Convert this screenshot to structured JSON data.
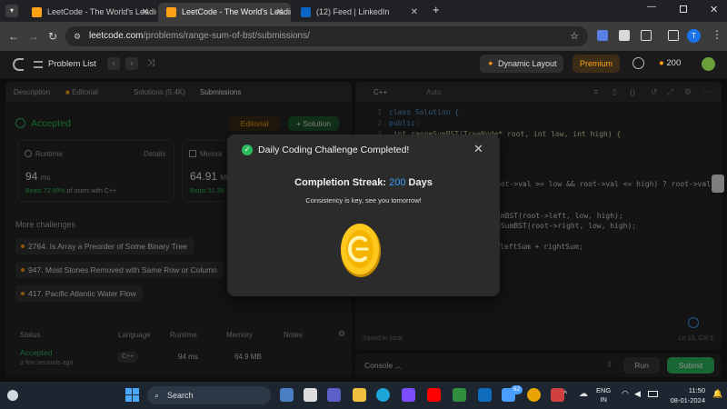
{
  "browser": {
    "tabs": [
      {
        "title": "LeetCode - The World's Leadin",
        "active": false
      },
      {
        "title": "LeetCode - The World's Leadin",
        "active": true
      },
      {
        "title": "(12) Feed | LinkedIn",
        "active": false
      }
    ],
    "url_host": "leetcode.com",
    "url_path": "/problems/range-sum-of-bst/submissions/",
    "profile_letter": "T"
  },
  "header": {
    "problem_list": "Problem List",
    "dynamic_layout": "Dynamic Layout",
    "premium": "Premium",
    "streak_count": "200"
  },
  "left_tabs": [
    "Description",
    "Editorial",
    "Solutions (5.4K)",
    "Submissions"
  ],
  "result": {
    "status": "Accepted",
    "editorial_btn": "Editorial",
    "solution_btn": "Solution",
    "runtime_label": "Runtime",
    "details": "Details",
    "runtime_value": "94",
    "runtime_unit": "ms",
    "runtime_beats": "Beats 72.99%",
    "runtime_beats_suffix": "of users with C++",
    "memory_label": "Memor",
    "memory_value": "64.91",
    "memory_unit": "MB",
    "memory_beats": "Beats 51.38"
  },
  "more_challenges": {
    "title": "More challenges",
    "items": [
      "2764. Is Array a Preorder of Some Binary Tree",
      "947. Most Stones Removed with Same Row or Column",
      "417. Pacific Atlantic Water Flow"
    ]
  },
  "table": {
    "headers": [
      "Status",
      "Language",
      "Runtime",
      "Memory",
      "Notes"
    ],
    "row": {
      "status": "Accepted",
      "time": "a few seconds ago",
      "language": "C++",
      "runtime": "94 ms",
      "memory": "64.9 MB"
    }
  },
  "editor": {
    "language": "C++",
    "mode": "Auto",
    "lines": [
      {
        "n": "1",
        "code": "class Solution {"
      },
      {
        "n": "2",
        "code": "public:"
      },
      {
        "n": "3",
        "code": "    int rangeSumBST(TreeNode* root, int low, int high) {"
      }
    ],
    "right_fragments": [
      "oot->val >= low && root->val <= high) ? root->val :",
      "umBST(root->left, low, high);",
      "eSumBST(root->right, low, high);",
      "leftSum + rightSum;"
    ],
    "saved": "Saved to local",
    "position": "Ln 13, Col 3",
    "console": "Console",
    "run": "Run",
    "submit": "Submit"
  },
  "modal": {
    "title": "Daily Coding Challenge Completed!",
    "streak_label": "Completion Streak:",
    "streak_value": "200",
    "streak_unit": "Days",
    "message": "Consistency is key, see you tomorrow!"
  },
  "taskbar": {
    "search": "Search",
    "lang_top": "ENG",
    "lang_bottom": "IN",
    "time": "11:50",
    "date": "08-01-2024",
    "badge": "62"
  },
  "colors": {
    "accent_orange": "#ffa116",
    "success_green": "#2cbb5d",
    "streak_blue": "#3b9eff"
  }
}
